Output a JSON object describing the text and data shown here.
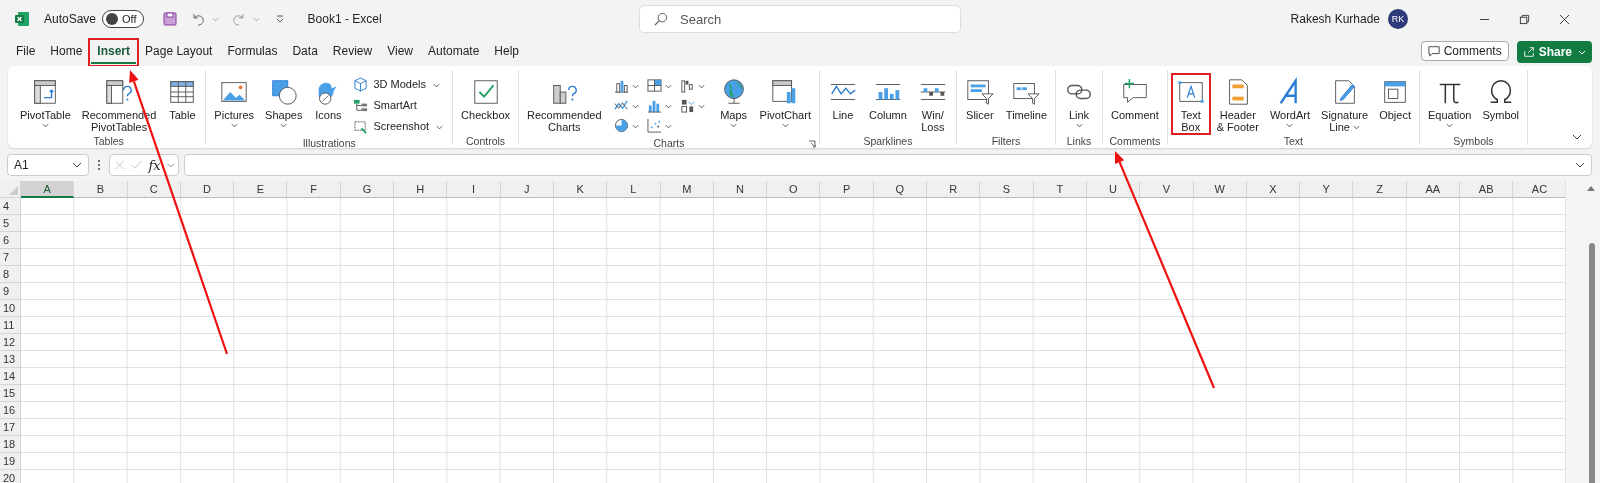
{
  "title_bar": {
    "autosave_label": "AutoSave",
    "autosave": {
      "label": "Off",
      "on": false
    },
    "title": "Book1 - Excel",
    "search": {
      "placeholder": "Search"
    },
    "user_name": "Rakesh Kurhade",
    "avatar_initials": "RK"
  },
  "tabs": [
    {
      "label": "File",
      "selected": false,
      "highlighted": false
    },
    {
      "label": "Home",
      "selected": false,
      "highlighted": false
    },
    {
      "label": "Insert",
      "selected": true,
      "highlighted": true
    },
    {
      "label": "Page Layout",
      "selected": false,
      "highlighted": false
    },
    {
      "label": "Formulas",
      "selected": false,
      "highlighted": false
    },
    {
      "label": "Data",
      "selected": false,
      "highlighted": false
    },
    {
      "label": "Review",
      "selected": false,
      "highlighted": false
    },
    {
      "label": "View",
      "selected": false,
      "highlighted": false
    },
    {
      "label": "Automate",
      "selected": false,
      "highlighted": false
    },
    {
      "label": "Help",
      "selected": false,
      "highlighted": false
    }
  ],
  "comments_button": "Comments",
  "share_button": "Share",
  "ribbon": {
    "groups": [
      {
        "label": "Tables",
        "items": [
          {
            "kind": "large",
            "label": "PivotTable",
            "dropdown": true,
            "highlighted": false
          },
          {
            "kind": "large",
            "label": "Recommended\nPivotTables",
            "dropdown": false,
            "highlighted": false
          },
          {
            "kind": "large",
            "label": "Table",
            "dropdown": false,
            "highlighted": false
          }
        ]
      },
      {
        "label": "Illustrations",
        "items": [
          {
            "kind": "large",
            "label": "Pictures",
            "dropdown": true,
            "highlighted": false
          },
          {
            "kind": "large",
            "label": "Shapes",
            "dropdown": true,
            "highlighted": false
          },
          {
            "kind": "large",
            "label": "Icons",
            "dropdown": false,
            "highlighted": false
          },
          {
            "kind": "stack",
            "items": [
              {
                "label": "3D Models",
                "dropdown": true
              },
              {
                "label": "SmartArt",
                "dropdown": false
              },
              {
                "label": "Screenshot",
                "dropdown": true
              }
            ]
          }
        ]
      },
      {
        "label": "Controls",
        "items": [
          {
            "kind": "large",
            "label": "Checkbox",
            "dropdown": false,
            "highlighted": false
          }
        ]
      },
      {
        "label": "Charts",
        "launcher": true,
        "items": [
          {
            "kind": "large",
            "label": "Recommended\nCharts",
            "dropdown": false,
            "highlighted": false
          },
          {
            "kind": "gallery",
            "items": [
              {
                "dropdown": true
              },
              {
                "dropdown": true
              },
              {
                "dropdown": true
              },
              {
                "dropdown": true
              },
              {
                "dropdown": true
              },
              {
                "dropdown": true
              },
              {
                "dropdown": true
              },
              {
                "dropdown": true
              }
            ]
          },
          {
            "kind": "large",
            "label": "Maps",
            "dropdown": true,
            "highlighted": false
          },
          {
            "kind": "large",
            "label": "PivotChart",
            "dropdown": true,
            "highlighted": false
          }
        ]
      },
      {
        "label": "Sparklines",
        "items": [
          {
            "kind": "large",
            "label": "Line",
            "dropdown": false,
            "highlighted": false
          },
          {
            "kind": "large",
            "label": "Column",
            "dropdown": false,
            "highlighted": false
          },
          {
            "kind": "large",
            "label": "Win/\nLoss",
            "dropdown": false,
            "highlighted": false
          }
        ]
      },
      {
        "label": "Filters",
        "items": [
          {
            "kind": "large",
            "label": "Slicer",
            "dropdown": false,
            "highlighted": false
          },
          {
            "kind": "large",
            "label": "Timeline",
            "dropdown": false,
            "highlighted": false
          }
        ]
      },
      {
        "label": "Links",
        "items": [
          {
            "kind": "large",
            "label": "Link",
            "dropdown": true,
            "highlighted": false
          }
        ]
      },
      {
        "label": "Comments",
        "items": [
          {
            "kind": "large",
            "label": "Comment",
            "dropdown": false,
            "highlighted": false
          }
        ]
      },
      {
        "label": "Text",
        "items": [
          {
            "kind": "large",
            "label": "Text\nBox",
            "dropdown": false,
            "highlighted": true
          },
          {
            "kind": "large",
            "label": "Header\n& Footer",
            "dropdown": false,
            "highlighted": false
          },
          {
            "kind": "large",
            "label": "WordArt",
            "dropdown": true,
            "highlighted": false
          },
          {
            "kind": "large",
            "label": "Signature\nLine",
            "dropdown": true,
            "highlighted": false
          },
          {
            "kind": "large",
            "label": "Object",
            "dropdown": false,
            "highlighted": false
          }
        ]
      },
      {
        "label": "Symbols",
        "items": [
          {
            "kind": "large",
            "label": "Equation",
            "dropdown": true,
            "highlighted": false
          },
          {
            "kind": "large",
            "label": "Symbol",
            "dropdown": false,
            "highlighted": false
          }
        ]
      }
    ]
  },
  "formula_bar": {
    "name_box": "A1",
    "function_label": "fx"
  },
  "sheet": {
    "columns": [
      {
        "label": "A",
        "selected": true
      },
      {
        "label": "B",
        "selected": false
      },
      {
        "label": "C",
        "selected": false
      },
      {
        "label": "D",
        "selected": false
      },
      {
        "label": "E",
        "selected": false
      },
      {
        "label": "F",
        "selected": false
      },
      {
        "label": "G",
        "selected": false
      },
      {
        "label": "H",
        "selected": false
      },
      {
        "label": "I",
        "selected": false
      },
      {
        "label": "J",
        "selected": false
      },
      {
        "label": "K",
        "selected": false
      },
      {
        "label": "L",
        "selected": false
      },
      {
        "label": "M",
        "selected": false
      },
      {
        "label": "N",
        "selected": false
      },
      {
        "label": "O",
        "selected": false
      },
      {
        "label": "P",
        "selected": false
      },
      {
        "label": "Q",
        "selected": false
      },
      {
        "label": "R",
        "selected": false
      },
      {
        "label": "S",
        "selected": false
      },
      {
        "label": "T",
        "selected": false
      },
      {
        "label": "U",
        "selected": false
      },
      {
        "label": "V",
        "selected": false
      },
      {
        "label": "W",
        "selected": false
      },
      {
        "label": "X",
        "selected": false
      },
      {
        "label": "Y",
        "selected": false
      },
      {
        "label": "Z",
        "selected": false
      },
      {
        "label": "AA",
        "selected": false
      },
      {
        "label": "AB",
        "selected": false
      },
      {
        "label": "AC",
        "selected": false
      }
    ],
    "rows": [
      "4",
      "5",
      "6",
      "7",
      "8",
      "9",
      "10",
      "11",
      "12",
      "13",
      "14",
      "15",
      "16",
      "17",
      "18",
      "19",
      "20"
    ]
  }
}
